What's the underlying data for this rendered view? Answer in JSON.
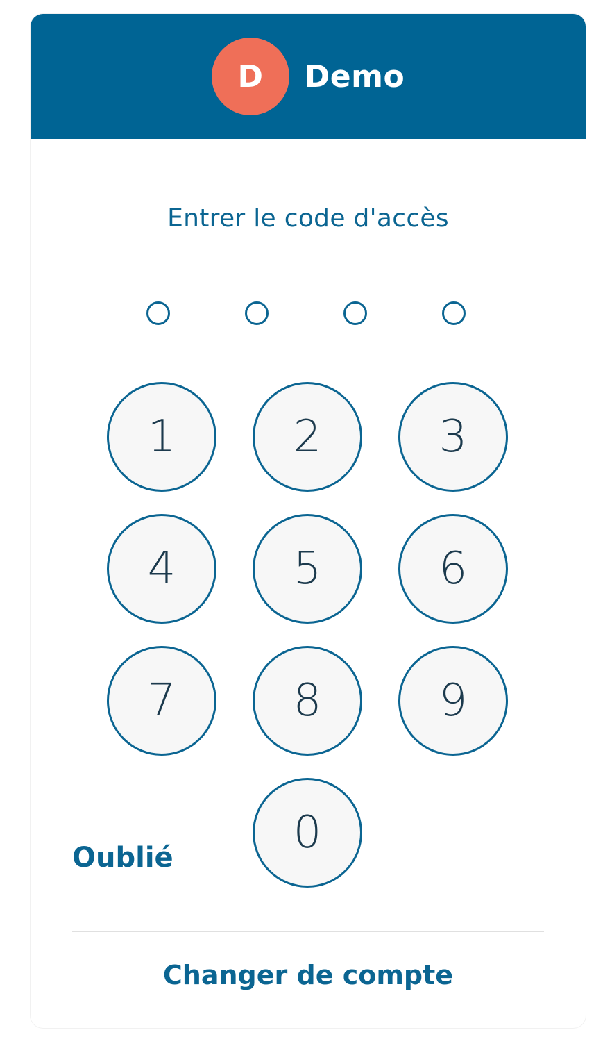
{
  "header": {
    "avatar_initial": "D",
    "account_name": "Demo",
    "background_color": "#006494",
    "avatar_color": "#ef6f58"
  },
  "prompt": "Entrer le code d'accès",
  "pin": {
    "length": 4,
    "filled": 0
  },
  "keypad": {
    "keys": [
      "1",
      "2",
      "3",
      "4",
      "5",
      "6",
      "7",
      "8",
      "9",
      "0"
    ]
  },
  "forgot_label": "Oublié",
  "switch_account_label": "Changer de compte",
  "accent_color": "#0b6592"
}
